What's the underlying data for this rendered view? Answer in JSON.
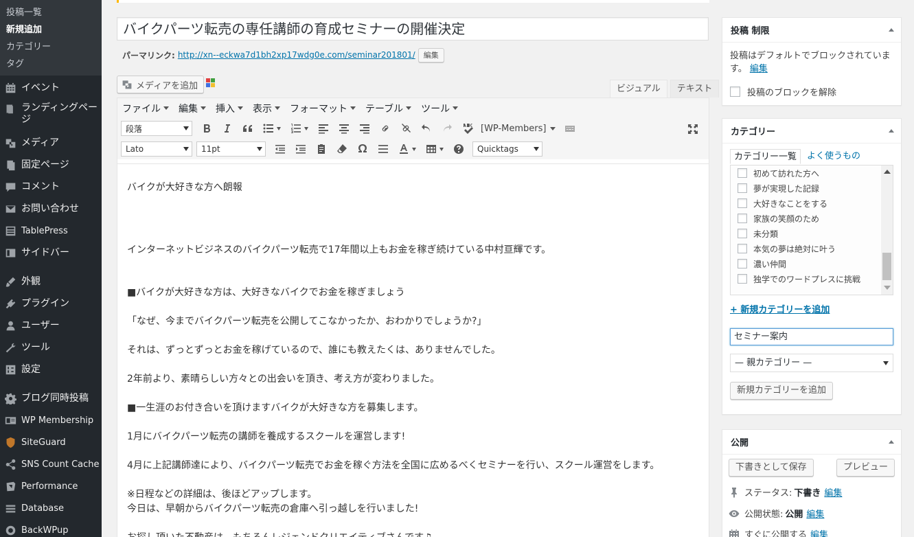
{
  "sidebar": {
    "submenu": [
      "投稿一覧",
      "新規追加",
      "カテゴリー",
      "タグ"
    ],
    "items": [
      {
        "label": "イベント",
        "icon": "calendar-icon"
      },
      {
        "label": "ランディングページ",
        "icon": "landing-icon"
      },
      {
        "label": "メディア",
        "icon": "media-icon"
      },
      {
        "label": "固定ページ",
        "icon": "page-icon"
      },
      {
        "label": "コメント",
        "icon": "comment-icon"
      },
      {
        "label": "お問い合わせ",
        "icon": "mail-icon"
      },
      {
        "label": "TablePress",
        "icon": "table-icon"
      },
      {
        "label": "サイドバー",
        "icon": "sidebar-icon"
      },
      {
        "label": "外観",
        "icon": "brush-icon"
      },
      {
        "label": "プラグイン",
        "icon": "plugin-icon"
      },
      {
        "label": "ユーザー",
        "icon": "user-icon"
      },
      {
        "label": "ツール",
        "icon": "wrench-icon"
      },
      {
        "label": "設定",
        "icon": "settings-icon"
      },
      {
        "label": "ブログ同時投稿",
        "icon": "gear-icon"
      },
      {
        "label": "WP Membership",
        "icon": "membership-icon"
      },
      {
        "label": "SiteGuard",
        "icon": "shield-icon"
      },
      {
        "label": "SNS Count Cache",
        "icon": "share-icon"
      },
      {
        "label": "Performance",
        "icon": "performance-icon"
      },
      {
        "label": "Database",
        "icon": "database-icon"
      },
      {
        "label": "BackWPup",
        "icon": "backup-icon"
      }
    ]
  },
  "post": {
    "title": "バイクパーツ転売の専任講師の育成セミナーの開催決定",
    "permalink_label": "パーマリンク:",
    "permalink_url": "http://xn--eckwa7d1bh2xp17wdg0e.com/seminar201801/",
    "edit_label": "編集"
  },
  "editor": {
    "add_media": "メディアを追加",
    "tabs": [
      "ビジュアル",
      "テキスト"
    ],
    "menus": [
      "ファイル",
      "編集",
      "挿入",
      "表示",
      "フォーマット",
      "テーブル",
      "ツール"
    ],
    "format_select": "段落",
    "font_select": "Lato",
    "size_select": "11pt",
    "wp_members": "[WP-Members]",
    "quicktags": "Quicktags",
    "paragraphs": [
      "バイクが大好きな方へ朗報",
      "インターネットビジネスのバイクパーツ転売で17年間以上もお金を稼ぎ続けている中村亘輝です。",
      "■バイクが大好きな方は、大好きなバイクでお金を稼ぎましょう",
      "「なぜ、今までバイクパーツ転売を公開してこなかったか、おわかりでしょうか?」",
      "それは、ずっとずっとお金を稼げているので、誰にも教えたくは、ありませんでした。",
      "2年前より、素晴らしい方々との出会いを頂き、考え方が変わりました。",
      "■一生涯のお付き合いを頂けますバイクが大好きな方を募集します。",
      "1月にバイクパーツ転売の講師を養成するスクールを運営します!",
      "4月に上記講師達により、バイクパーツ転売でお金を稼ぐ方法を全国に広めるべくセミナーを行い、スクール運営をします。",
      "※日程などの詳細は、後ほどアップします。",
      "今日は、早朝からバイクパーツ転売の倉庫へ引っ越しを行いました!",
      "お探し頂いた不動産は、もちろんレジェンドクリエイティブさんです♫"
    ]
  },
  "restrict_box": {
    "title": "投稿 制限",
    "desc": "投稿はデフォルトでブロックされています。",
    "edit": "編集",
    "checkbox_label": "投稿のブロックを解除"
  },
  "category_box": {
    "title": "カテゴリー",
    "tab_all": "カテゴリー一覧",
    "tab_popular": "よく使うもの",
    "items": [
      "初めて訪れた方へ",
      "夢が実現した記録",
      "大好きなことをする",
      "家族の笑顔のため",
      "未分類",
      "本気の夢は絶対に叶う",
      "濃い仲間",
      "独学でのワードプレスに挑戦"
    ],
    "add_link": "+ 新規カテゴリーを追加",
    "new_cat_value": "セミナー案内",
    "parent_select": "— 親カテゴリー —",
    "add_button": "新規カテゴリーを追加"
  },
  "publish_box": {
    "title": "公開",
    "save_draft": "下書きとして保存",
    "preview": "プレビュー",
    "status_label": "ステータス:",
    "status_value": "下書き",
    "visibility_label": "公開状態:",
    "visibility_value": "公開",
    "schedule_label": "すぐに公開する",
    "edit": "編集"
  }
}
